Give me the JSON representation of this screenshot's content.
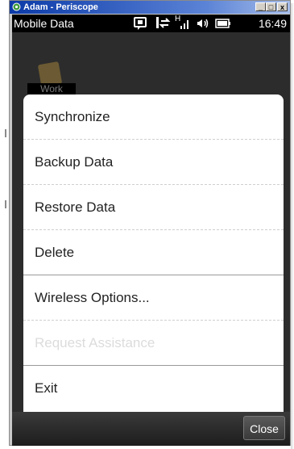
{
  "window": {
    "title": "Adam - Periscope",
    "minimize": "_",
    "maximize": "□",
    "close": "x"
  },
  "statusbar": {
    "carrier": "Mobile Data",
    "time": "16:49",
    "signal_type": "H"
  },
  "background": {
    "tile_label": "Work"
  },
  "menu": {
    "items": [
      {
        "label": "Synchronize"
      },
      {
        "label": "Backup Data"
      },
      {
        "label": "Restore Data"
      },
      {
        "label": "Delete"
      },
      {
        "label": "Wireless Options..."
      },
      {
        "label": "Request Assistance"
      },
      {
        "label": "Exit"
      }
    ]
  },
  "bottombar": {
    "close_label": "Close"
  },
  "colors": {
    "menu_text": "#222222",
    "disabled_text": "#dcdcdc",
    "titlebar_start": "#0b3aa8"
  }
}
